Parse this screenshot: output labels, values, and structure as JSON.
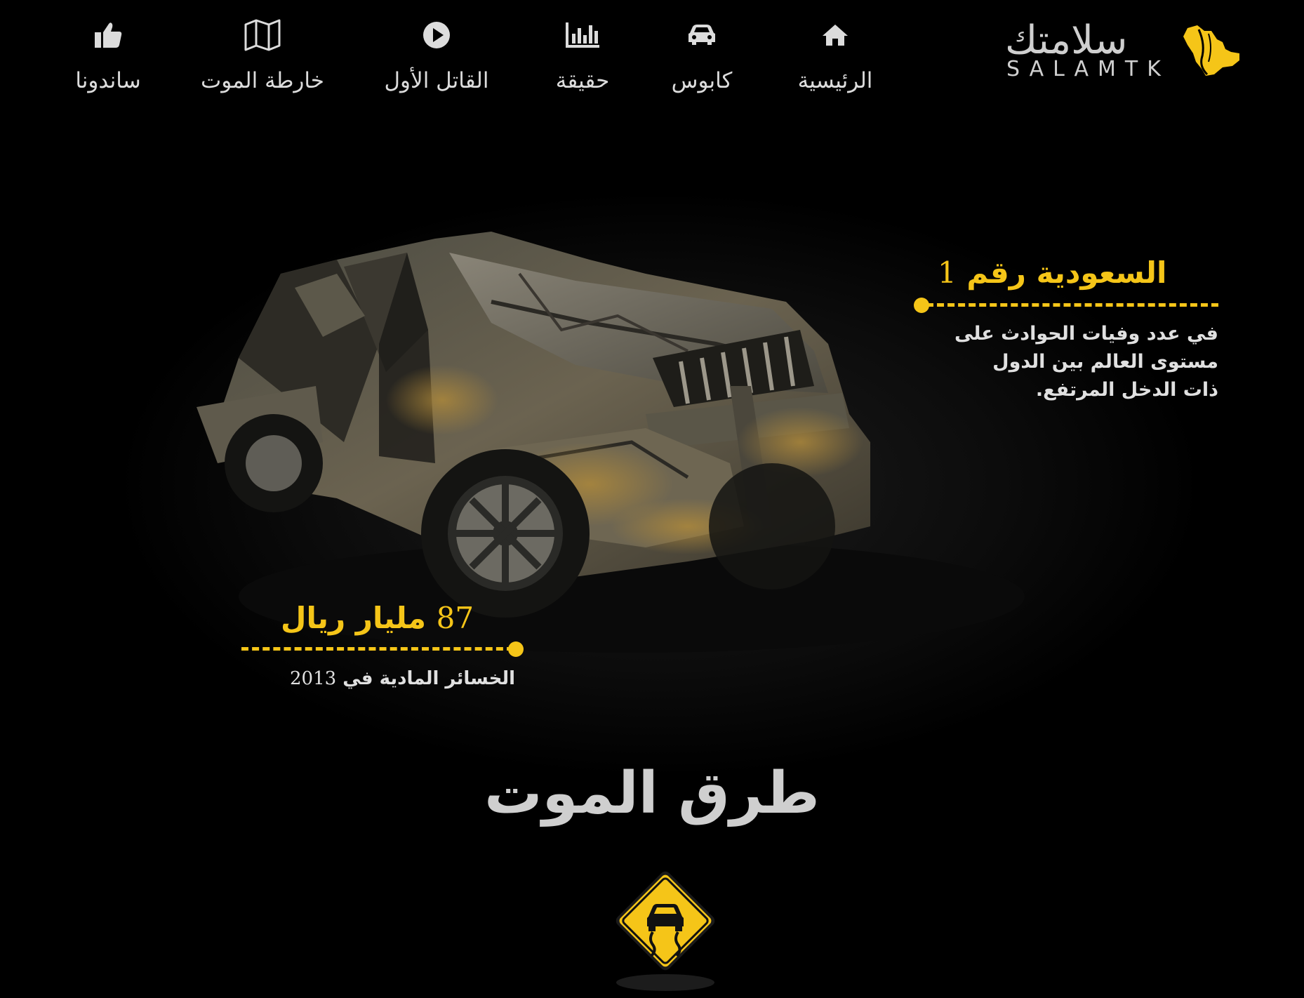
{
  "nav": {
    "items": [
      {
        "label": "الرئيسية",
        "icon": "home-icon"
      },
      {
        "label": "كابوس",
        "icon": "car-icon"
      },
      {
        "label": "حقيقة",
        "icon": "bar-chart-icon"
      },
      {
        "label": "القاتل الأول",
        "icon": "play-icon"
      },
      {
        "label": "خارطة الموت",
        "icon": "map-icon"
      },
      {
        "label": "ساندونا",
        "icon": "thumbs-up-icon"
      }
    ]
  },
  "logo": {
    "arabic": "سلامتك",
    "latin": "SALAMTK",
    "accent_color": "#f5c518"
  },
  "stats": {
    "rank": {
      "title": "السعودية رقم",
      "number": "1",
      "description_lines": [
        "في عدد وفيات الحوادث على",
        "مستوى العالم بين الدول",
        "ذات الدخل المرتفع."
      ]
    },
    "losses": {
      "number": "87",
      "title": "مليار ريال",
      "description": "الخسائر المادية في",
      "year": "2013"
    }
  },
  "section": {
    "title": "طرق الموت",
    "icon": "slippery-road-warning-icon"
  },
  "colors": {
    "accent": "#f5c518",
    "background": "#000000",
    "text": "#dcdcdc"
  }
}
